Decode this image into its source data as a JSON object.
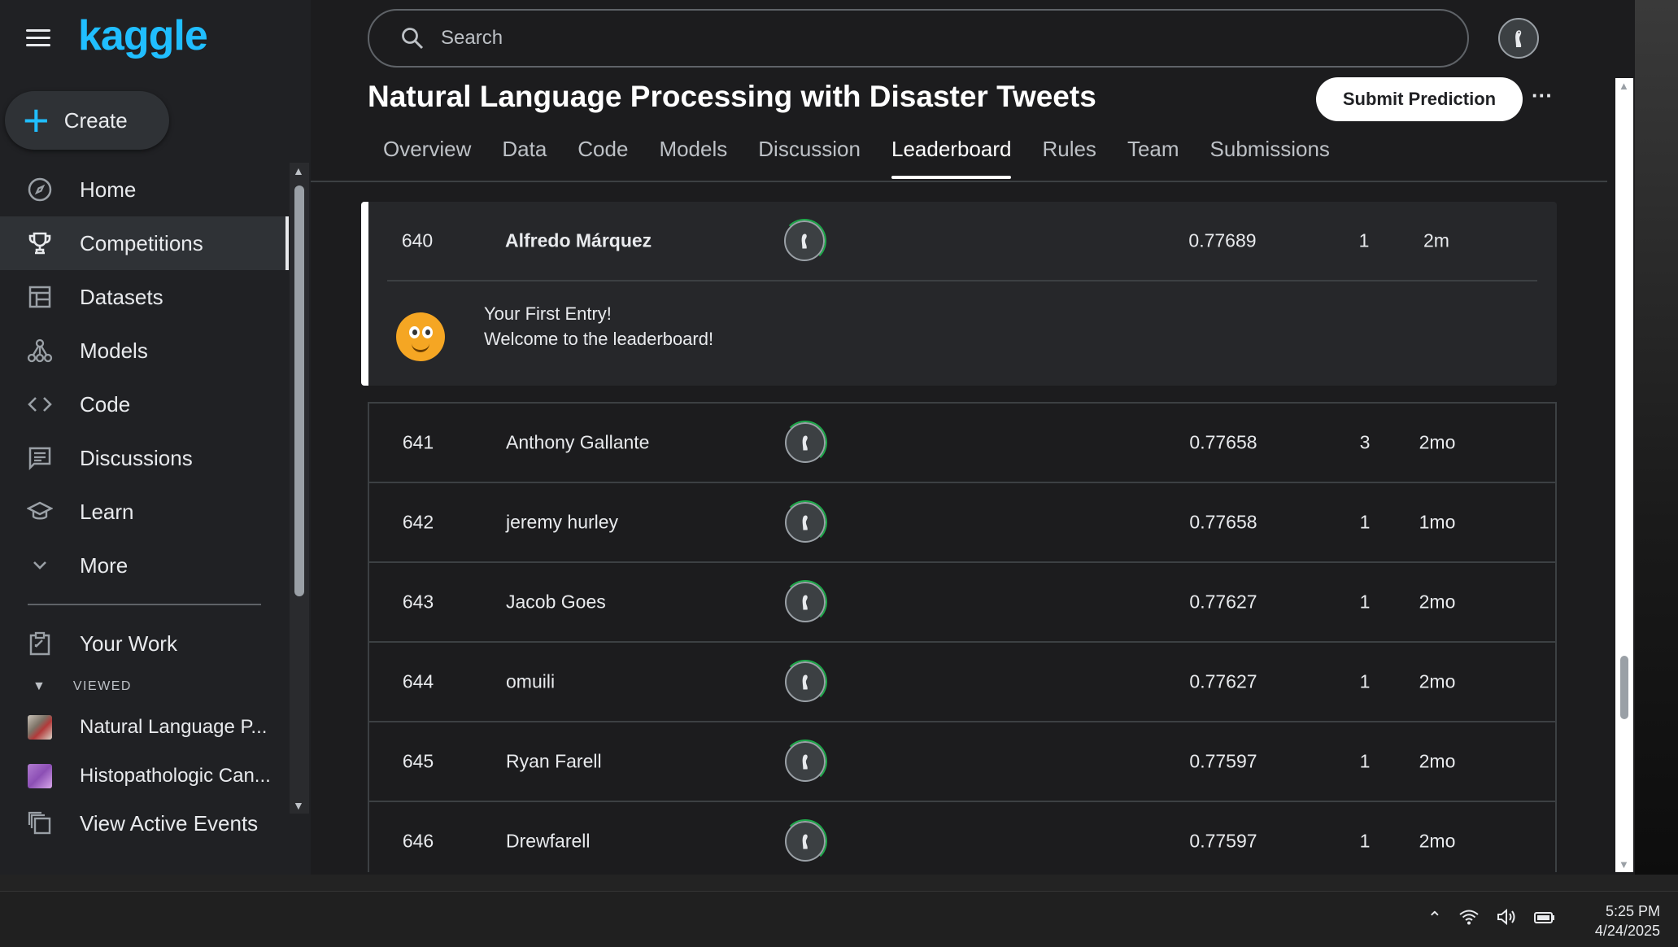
{
  "sidebar": {
    "logo": "kaggle",
    "create_label": "Create",
    "items": [
      {
        "label": "Home",
        "icon": "compass-icon"
      },
      {
        "label": "Competitions",
        "icon": "trophy-icon",
        "active": true
      },
      {
        "label": "Datasets",
        "icon": "table-icon"
      },
      {
        "label": "Models",
        "icon": "models-icon"
      },
      {
        "label": "Code",
        "icon": "code-icon"
      },
      {
        "label": "Discussions",
        "icon": "discussion-icon"
      },
      {
        "label": "Learn",
        "icon": "school-icon"
      },
      {
        "label": "More",
        "icon": "chevron-down-icon"
      }
    ],
    "your_work": "Your Work",
    "viewed_header": "VIEWED",
    "viewed": [
      {
        "label": "Natural Language P..."
      },
      {
        "label": "Histopathologic Can..."
      }
    ],
    "view_active_events": "View Active Events"
  },
  "search": {
    "placeholder": "Search"
  },
  "header": {
    "title": "Natural Language Processing with Disaster Tweets",
    "submit_label": "Submit Prediction",
    "more_label": "···",
    "tabs": [
      "Overview",
      "Data",
      "Code",
      "Models",
      "Discussion",
      "Leaderboard",
      "Rules",
      "Team",
      "Submissions"
    ],
    "active_tab": "Leaderboard"
  },
  "my_entry": {
    "rank": "640",
    "name": "Alfredo Márquez",
    "score": "0.77689",
    "entries": "1",
    "last": "2m",
    "message_line1": "Your First Entry!",
    "message_line2": "Welcome to the leaderboard!"
  },
  "leaderboard": [
    {
      "rank": "641",
      "name": "Anthony Gallante",
      "score": "0.77658",
      "entries": "3",
      "last": "2mo"
    },
    {
      "rank": "642",
      "name": "jeremy hurley",
      "score": "0.77658",
      "entries": "1",
      "last": "1mo"
    },
    {
      "rank": "643",
      "name": "Jacob Goes",
      "score": "0.77627",
      "entries": "1",
      "last": "2mo"
    },
    {
      "rank": "644",
      "name": "omuili",
      "score": "0.77627",
      "entries": "1",
      "last": "2mo"
    },
    {
      "rank": "645",
      "name": "Ryan Farell",
      "score": "0.77597",
      "entries": "1",
      "last": "2mo"
    },
    {
      "rank": "646",
      "name": "Drewfarell",
      "score": "0.77597",
      "entries": "1",
      "last": "2mo"
    }
  ],
  "taskbar": {
    "time": "5:25 PM",
    "date": "4/24/2025"
  },
  "colors": {
    "accent": "#20beff",
    "background": "#202124",
    "progress_ring": "#1ea84a"
  }
}
